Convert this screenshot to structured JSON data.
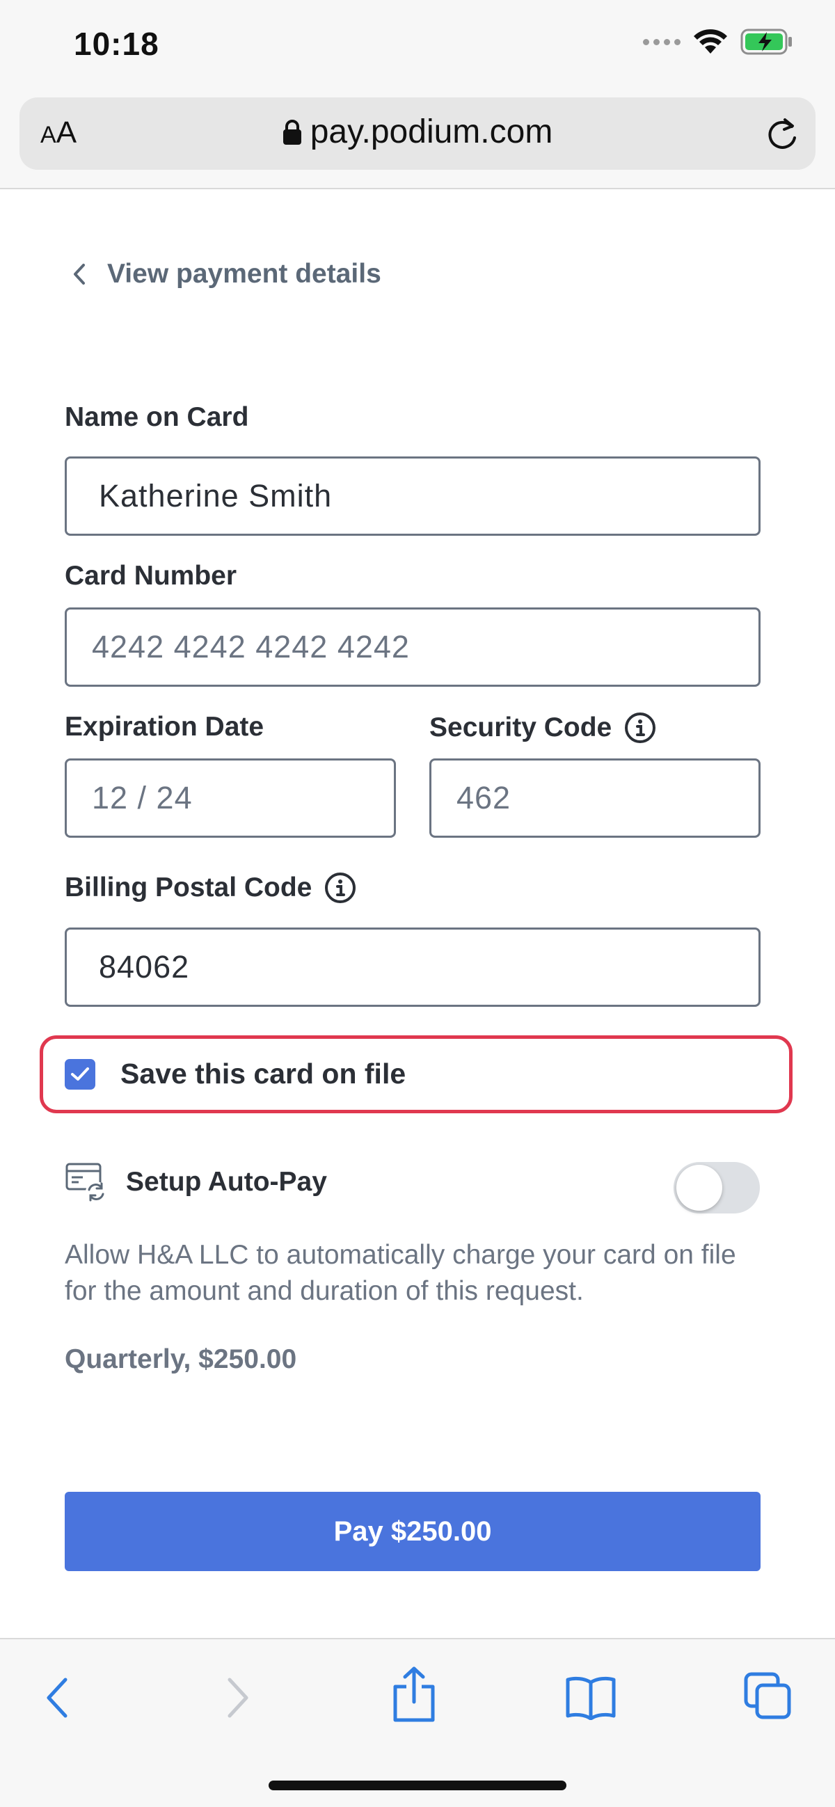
{
  "status_bar": {
    "time": "10:18"
  },
  "browser": {
    "text_size_label_small": "A",
    "text_size_label_large": "A",
    "url": "pay.podium.com"
  },
  "page": {
    "back_label": "View payment details",
    "fields": {
      "name": {
        "label": "Name on Card",
        "value": "Katherine Smith"
      },
      "card_number": {
        "label": "Card Number",
        "placeholder": "4242 4242 4242 4242"
      },
      "expiration": {
        "label": "Expiration Date",
        "placeholder": "12 / 24"
      },
      "security": {
        "label": "Security Code",
        "placeholder": "462"
      },
      "postal": {
        "label": "Billing Postal Code",
        "value": "84062"
      }
    },
    "save_card": {
      "label": "Save this card on file",
      "checked": true
    },
    "autopay": {
      "label": "Setup Auto-Pay",
      "enabled": false,
      "description": "Allow H&A LLC to automatically charge your card on file for the amount and duration of this request.",
      "schedule": "Quarterly, $250.00"
    },
    "pay_button": "Pay $250.00"
  },
  "colors": {
    "accent": "#4a74dd",
    "highlight": "#e0384f",
    "ios_blue": "#2f7de1"
  }
}
